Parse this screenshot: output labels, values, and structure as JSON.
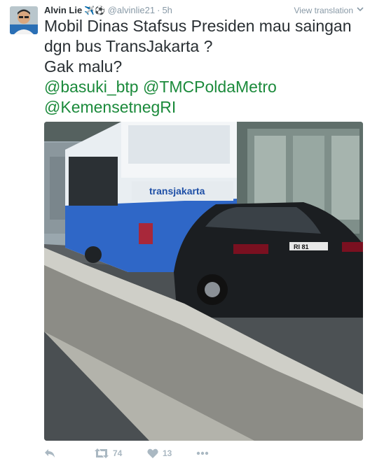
{
  "author": {
    "name": "Alvin Lie",
    "badges": "✈️⚽",
    "handle": "@alvinlie21",
    "separator": "·",
    "time": "5h"
  },
  "translate_label": "View translation",
  "tweet": {
    "line1": "Mobil Dinas Stafsus Presiden mau saingan",
    "line2": "dgn bus TransJakarta ?",
    "line3": "Gak malu?",
    "mention1": "@basuki_btp",
    "mention2": "@TMCPoldaMetro",
    "mention3": "@KemensetnegRI"
  },
  "photo": {
    "bus_brand": "transjakarta",
    "plate": "RI 81"
  },
  "actions": {
    "retweet_count": "74",
    "like_count": "13"
  },
  "icons": [
    "reply-icon",
    "retweet-icon",
    "like-icon",
    "more-icon",
    "chevron-down-icon"
  ],
  "colors": {
    "mention": "#1b8a3b",
    "meta": "#8899a6",
    "action": "#aab8c2"
  }
}
